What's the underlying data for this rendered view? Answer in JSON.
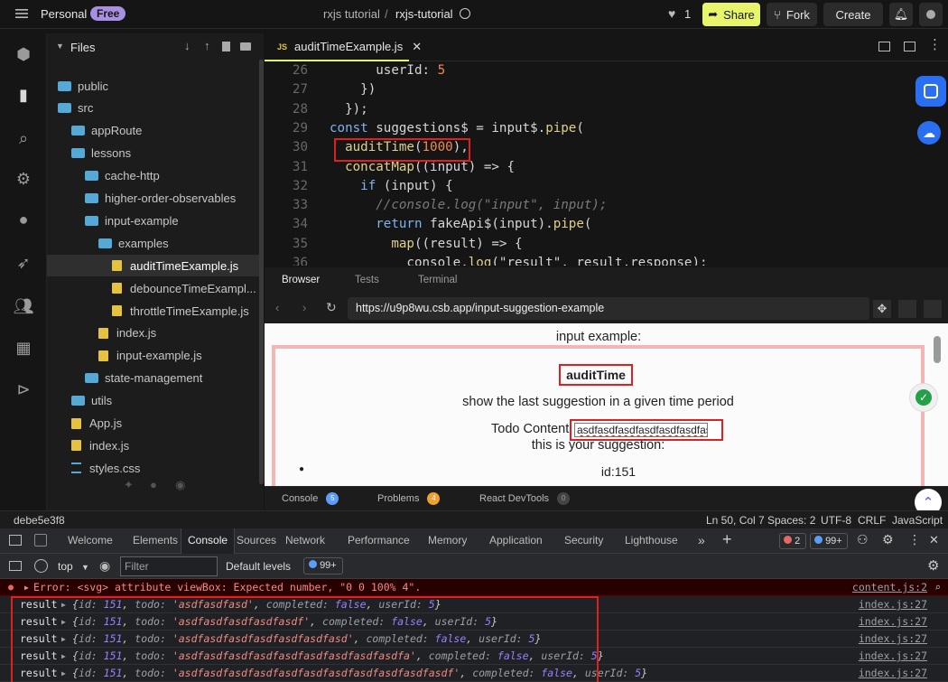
{
  "topbar": {
    "workspace": "Personal",
    "plan_badge": "Free",
    "project_owner": "rxjs tutorial",
    "separator": "/",
    "project_name": "rxjs-tutorial",
    "likes": "1",
    "share_label": "Share",
    "fork_label": "Fork",
    "create_label": "Create"
  },
  "files": {
    "header": "Files",
    "tree": [
      {
        "name": "public",
        "type": "folder",
        "depth": 0
      },
      {
        "name": "src",
        "type": "folder-open",
        "depth": 0
      },
      {
        "name": "appRoute",
        "type": "folder",
        "depth": 1
      },
      {
        "name": "lessons",
        "type": "folder-open",
        "depth": 1
      },
      {
        "name": "cache-http",
        "type": "folder",
        "depth": 2
      },
      {
        "name": "higher-order-observables",
        "type": "folder",
        "depth": 2
      },
      {
        "name": "input-example",
        "type": "folder-open",
        "depth": 2
      },
      {
        "name": "examples",
        "type": "folder-open",
        "depth": 3
      },
      {
        "name": "auditTimeExample.js",
        "type": "js",
        "depth": 4,
        "selected": true
      },
      {
        "name": "debounceTimeExampl...",
        "type": "js",
        "depth": 4
      },
      {
        "name": "throttleTimeExample.js",
        "type": "js",
        "depth": 4
      },
      {
        "name": "index.js",
        "type": "js",
        "depth": 3
      },
      {
        "name": "input-example.js",
        "type": "js",
        "depth": 3
      },
      {
        "name": "state-management",
        "type": "folder",
        "depth": 2
      },
      {
        "name": "utils",
        "type": "folder",
        "depth": 1
      },
      {
        "name": "App.js",
        "type": "js",
        "depth": 1
      },
      {
        "name": "index.js",
        "type": "js",
        "depth": 1
      },
      {
        "name": "styles.css",
        "type": "css",
        "depth": 1
      }
    ]
  },
  "editor": {
    "tab_label": "auditTimeExample.js",
    "tab_badge": "JS",
    "lines": [
      {
        "n": "26",
        "text": "      userId: 5"
      },
      {
        "n": "27",
        "text": "    })"
      },
      {
        "n": "28",
        "text": "  });"
      },
      {
        "n": "29",
        "text": "const suggestions$ = input$.pipe("
      },
      {
        "n": "30",
        "text": "  auditTime(1000),"
      },
      {
        "n": "31",
        "text": "  concatMap((input) => {"
      },
      {
        "n": "32",
        "text": "    if (input) {"
      },
      {
        "n": "33",
        "text": "      //console.log(\"input\", input);"
      },
      {
        "n": "34",
        "text": "      return fakeApi$(input).pipe("
      },
      {
        "n": "35",
        "text": "        map((result) => {"
      },
      {
        "n": "36",
        "text": "          console.log(\"result\", result.response);"
      }
    ]
  },
  "preview": {
    "tabs": [
      "Browser",
      "Tests",
      "Terminal"
    ],
    "active_tab": "Browser",
    "url": "https://u9p8wu.csb.app/input-suggestion-example",
    "page": {
      "title": "input example:",
      "heading": "auditTime",
      "description": "show the last suggestion in a given time period",
      "todo_label": "Todo Content:",
      "todo_value": "asdfasdfasdfasdfasdfasdfasdf",
      "suggestion_label": "this is your suggestion:",
      "list_item": "id:151"
    },
    "bottom_tabs": [
      {
        "label": "Console",
        "count": "5"
      },
      {
        "label": "Problems",
        "count": "4"
      },
      {
        "label": "React DevTools",
        "count": "0"
      }
    ]
  },
  "status": {
    "commit": "debe5e3f8",
    "position": "Ln 50, Col 7",
    "spaces": "Spaces: 2",
    "encoding": "UTF-8",
    "eol": "CRLF",
    "language": "JavaScript"
  },
  "devtools": {
    "tabs": [
      "Welcome",
      "Elements",
      "Console",
      "Sources",
      "Network",
      "Performance",
      "Memory",
      "Application",
      "Security",
      "Lighthouse"
    ],
    "active_tab": "Console",
    "error_count": "2",
    "issue_count": "99+",
    "context": "top",
    "filter_placeholder": "Filter",
    "levels": "Default levels",
    "toolbar_issues": "99+",
    "error": {
      "text": "Error: <svg> attribute viewBox: Expected number, \"0 0 100% 4\".",
      "source": "content.js:2"
    },
    "logs": [
      {
        "label": "result",
        "id": "151",
        "todo": "'asdfasdfasd'",
        "completed": "false",
        "userId": "5",
        "source": "index.js:27"
      },
      {
        "label": "result",
        "id": "151",
        "todo": "'asdfasdfasdfasdfasdf'",
        "completed": "false",
        "userId": "5",
        "source": "index.js:27"
      },
      {
        "label": "result",
        "id": "151",
        "todo": "'asdfasdfasdfasdfasdfasdfasd'",
        "completed": "false",
        "userId": "5",
        "source": "index.js:27"
      },
      {
        "label": "result",
        "id": "151",
        "todo": "'asdfasdfasdfasdfasdfasdfasdfasdfasdfa'",
        "completed": "false",
        "userId": "5",
        "source": "index.js:27"
      },
      {
        "label": "result",
        "id": "151",
        "todo": "'asdfasdfasdfasdfasdfasdfasdfasdfasdfasdfasdf'",
        "completed": "false",
        "userId": "5",
        "source": "index.js:27"
      }
    ]
  },
  "colors": {
    "accent_yellow": "#e6f56c",
    "folder_blue": "#54a9d6",
    "js_yellow": "#e5c341",
    "highlight_red": "#e02020"
  }
}
